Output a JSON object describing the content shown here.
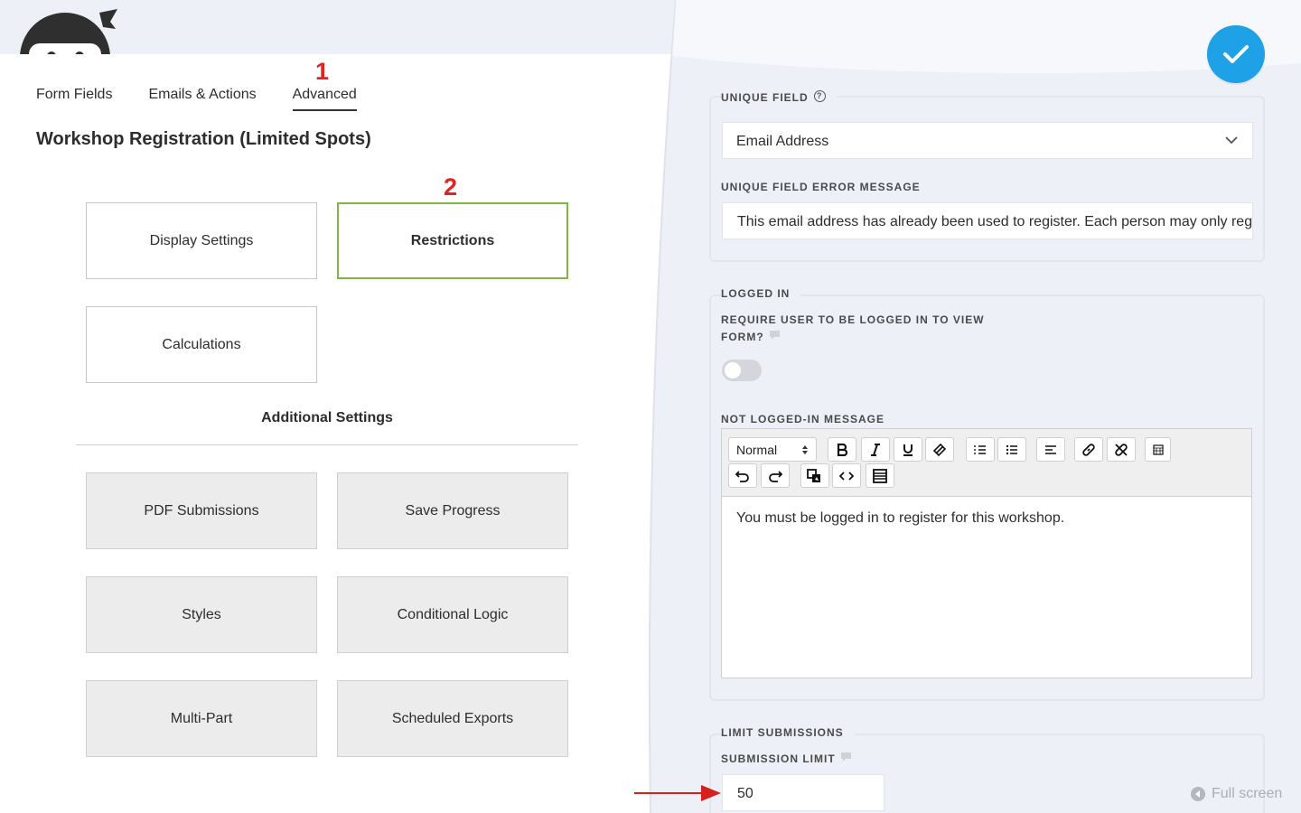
{
  "tabs": [
    {
      "label": "Form Fields",
      "active": false
    },
    {
      "label": "Emails & Actions",
      "active": false
    },
    {
      "label": "Advanced",
      "active": true
    }
  ],
  "markers": {
    "one": "1",
    "two": "2"
  },
  "form_title": "Workshop Registration (Limited Spots)",
  "settings_cards": {
    "display": "Display Settings",
    "restrictions": "Restrictions",
    "calculations": "Calculations"
  },
  "additional_settings": {
    "title": "Additional Settings",
    "items": [
      "PDF Submissions",
      "Save Progress",
      "Styles",
      "Conditional Logic",
      "Multi-Part",
      "Scheduled Exports"
    ]
  },
  "unique_field": {
    "legend": "UNIQUE FIELD",
    "help_glyph": "?",
    "selected": "Email Address",
    "error_label": "UNIQUE FIELD ERROR MESSAGE",
    "error_value": "This email address has already been used to register. Each person may only register once."
  },
  "logged_in": {
    "legend": "LOGGED IN",
    "require_label_1": "REQUIRE USER TO BE LOGGED IN TO VIEW",
    "require_label_2": "FORM?",
    "require_enabled": false,
    "message_label": "NOT LOGGED-IN MESSAGE",
    "format_select": "Normal",
    "message": "You must be logged in to register for this workshop."
  },
  "limit_submissions": {
    "legend": "LIMIT SUBMISSIONS",
    "limit_label": "SUBMISSION LIMIT",
    "limit_value": "50"
  },
  "fullscreen_label": "Full screen",
  "colors": {
    "accent_blue": "#1ea1e6",
    "selected_green": "#82b541",
    "marker_red": "#e02424",
    "drawer_bg": "#eef0f7"
  }
}
